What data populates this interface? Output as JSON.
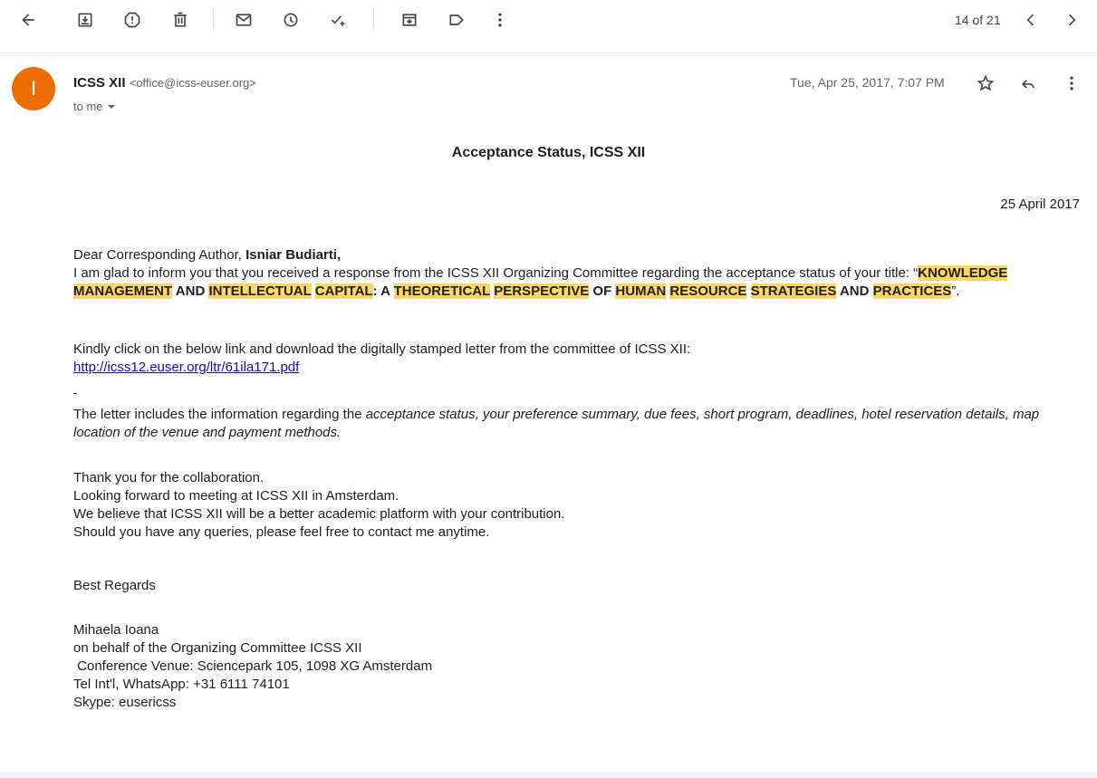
{
  "toolbar": {
    "count": "14 of 21",
    "icons": [
      "back-arrow-icon",
      "archive-icon",
      "report-spam-icon",
      "delete-icon",
      "mark-unread-icon",
      "snooze-icon",
      "add-task-icon",
      "move-to-icon",
      "label-icon",
      "more-vert-icon",
      "prev-icon",
      "next-icon"
    ]
  },
  "header": {
    "avatar_letter": "I",
    "avatar_color": "#ef6c00",
    "sender_name": "ICSS XII",
    "sender_email": "<office@icss-euser.org>",
    "to": "to me",
    "date": "Tue, Apr 25, 2017, 7:07 PM"
  },
  "message": {
    "subject": "Acceptance Status, ICSS XII",
    "letter_date": "25 April 2017",
    "salutation_prefix": "Dear Corresponding Author, ",
    "salutation_name": "Isniar Budiarti,",
    "intro": "I am glad to inform you that you received a response from the ICSS XII Organizing Committee regarding the acceptance status of your title: “",
    "title_parts": [
      {
        "text": "KNOWLEDGE",
        "hl": true
      },
      {
        "text": " ",
        "hl": false
      },
      {
        "text": "MANAGEMENT",
        "hl": true
      },
      {
        "text": " AND ",
        "hl": false
      },
      {
        "text": "INTELLECTUAL",
        "hl": true
      },
      {
        "text": " ",
        "hl": false
      },
      {
        "text": "CAPITAL",
        "hl": true
      },
      {
        "text": ": A ",
        "hl": false
      },
      {
        "text": "THEORETICAL",
        "hl": true
      },
      {
        "text": " ",
        "hl": false
      },
      {
        "text": "PERSPECTIVE",
        "hl": true
      },
      {
        "text": " OF ",
        "hl": false
      },
      {
        "text": "HUMAN",
        "hl": true
      },
      {
        "text": " ",
        "hl": false
      },
      {
        "text": "RESOURCE",
        "hl": true
      },
      {
        "text": " ",
        "hl": false
      },
      {
        "text": "STRATEGIES",
        "hl": true
      },
      {
        "text": " AND ",
        "hl": false
      },
      {
        "text": "PRACTICES",
        "hl": true
      }
    ],
    "title_close": "”.",
    "click_text": "Kindly click on the below link and download the digitally stamped letter from the committee of ICSS XII:",
    "link": "http://icss12.euser.org/ltr/61ila171.pdf",
    "info_prefix": "The letter includes the information regarding the ",
    "info_italic": "acceptance status, your preference summary, due fees, short program, deadlines, hotel reservation details, map location of the venue and payment methods.",
    "thanks_lines": [
      "Thank you for the collaboration.",
      "Looking forward to meeting at ICSS XII in Amsterdam.",
      "We believe that ICSS XII will be a better academic platform with your contribution.",
      "Should you have any queries, please feel free to contact me anytime."
    ],
    "closing": "Best Regards",
    "signature": [
      "Mihaela Ioana",
      "on behalf of the Organizing Committee ICSS XII",
      " Conference Venue: Sciencepark 105, 1098 XG Amsterdam",
      "Tel Int'l, WhatsApp: +31 6111 74101",
      "Skype: eusericss"
    ]
  }
}
